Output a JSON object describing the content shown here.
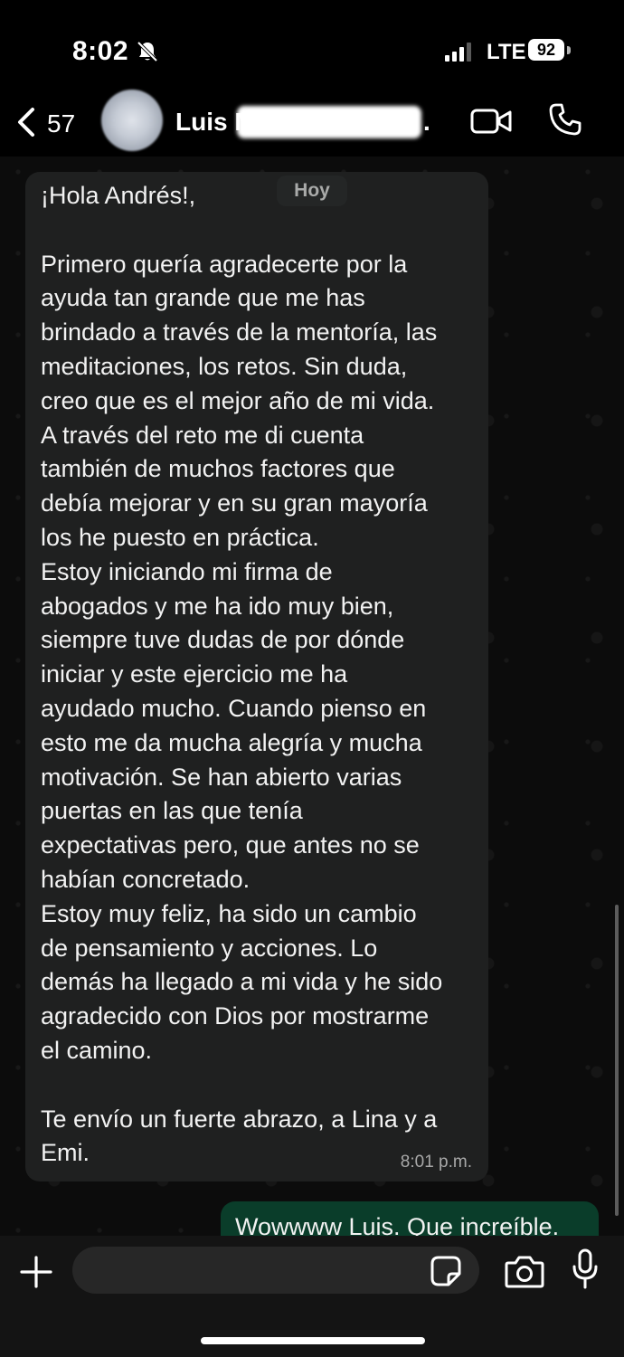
{
  "status_bar": {
    "time": "8:02",
    "network": "LTE",
    "battery": "92"
  },
  "header": {
    "unread_count": "57",
    "contact_name": "Luis Mi",
    "contact_suffix": "."
  },
  "chat": {
    "date_separator": "Hoy",
    "incoming_message": {
      "text": "¡Hola Andrés!,\n\nPrimero quería agradecerte por la\nayuda tan grande que me has\nbrindado a través de la mentoría, las\nmeditaciones, los retos. Sin duda,\ncreo que es el mejor año de mi vida.\nA través del reto me di cuenta\ntambién de muchos factores que\ndebía mejorar y en su gran mayoría\nlos he puesto en práctica.\nEstoy iniciando mi firma de\nabogados y me ha ido muy bien,\nsiempre tuve dudas de por dónde\niniciar y este ejercicio me ha\nayudado mucho. Cuando pienso en\nesto me da mucha alegría y mucha\nmotivación. Se han abierto varias\npuertas en las que tenía\nexpectativas pero, que antes no se\nhabían concretado.\nEstoy muy feliz, ha sido un cambio\nde pensamiento y acciones. Lo\ndemás ha llegado a mi vida y he sido\nagradecido con Dios por mostrarme\nel camino.\n\nTe envío un fuerte abrazo, a Lina y a\nEmi.",
      "time": "8:01 p.m."
    },
    "outgoing_message": {
      "text": "Wowwww Luis. Que increíble."
    }
  },
  "composer": {
    "placeholder": ""
  },
  "colors": {
    "incoming_bubble": "#1f2020",
    "outgoing_bubble": "#0a3d2a",
    "background": "#0b0b0b"
  },
  "icons": [
    "back-chevron-icon",
    "video-call-icon",
    "voice-call-icon",
    "plus-icon",
    "sticker-icon",
    "camera-icon",
    "microphone-icon",
    "bell-slash-icon"
  ]
}
